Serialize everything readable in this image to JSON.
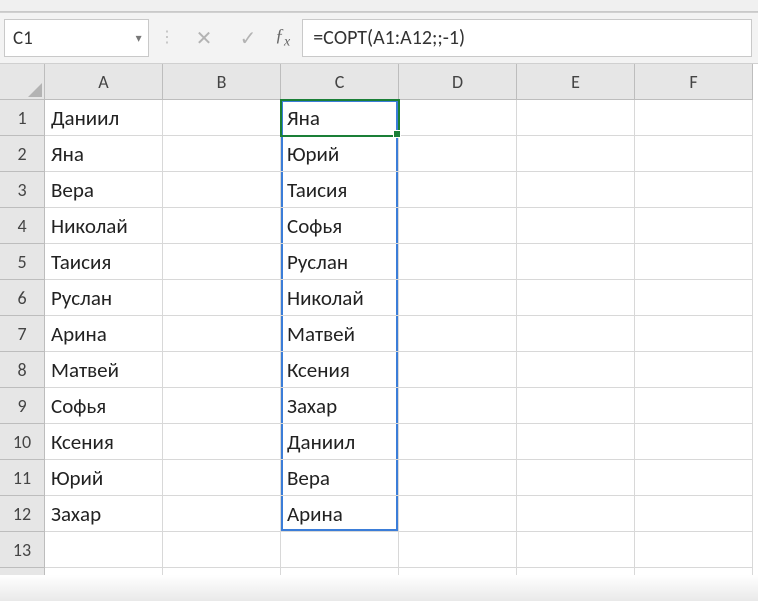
{
  "name_box": {
    "value": "C1"
  },
  "formula_bar": {
    "value": "=СОРТ(A1:A12;;-1)"
  },
  "columns": [
    "A",
    "B",
    "C",
    "D",
    "E",
    "F"
  ],
  "row_count": 14,
  "active_cell": "C1",
  "spill_range": "C1:C12",
  "cells": {
    "A": [
      "Даниил",
      "Яна",
      "Вера",
      "Николай",
      "Таисия",
      "Руслан",
      "Арина",
      "Матвей",
      "Софья",
      "Ксения",
      "Юрий",
      "Захар",
      "",
      ""
    ],
    "B": [
      "",
      "",
      "",
      "",
      "",
      "",
      "",
      "",
      "",
      "",
      "",
      "",
      "",
      ""
    ],
    "C": [
      "Яна",
      "Юрий",
      "Таисия",
      "Софья",
      "Руслан",
      "Николай",
      "Матвей",
      "Ксения",
      "Захар",
      "Даниил",
      "Вера",
      "Арина",
      "",
      ""
    ],
    "D": [
      "",
      "",
      "",
      "",
      "",
      "",
      "",
      "",
      "",
      "",
      "",
      "",
      "",
      ""
    ],
    "E": [
      "",
      "",
      "",
      "",
      "",
      "",
      "",
      "",
      "",
      "",
      "",
      "",
      "",
      ""
    ],
    "F": [
      "",
      "",
      "",
      "",
      "",
      "",
      "",
      "",
      "",
      "",
      "",
      "",
      "",
      ""
    ]
  }
}
